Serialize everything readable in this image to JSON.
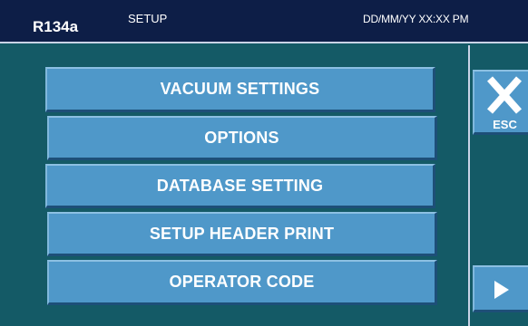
{
  "header": {
    "refrigerant": "R134a",
    "mode": "SETUP",
    "datetime": "DD/MM/YY XX:XX PM"
  },
  "menu": {
    "items": [
      {
        "label": "VACUUM SETTINGS"
      },
      {
        "label": "OPTIONS"
      },
      {
        "label": "DATABASE SETTING"
      },
      {
        "label": "SETUP HEADER PRINT"
      },
      {
        "label": "OPERATOR CODE"
      }
    ]
  },
  "side": {
    "esc_label": "ESC",
    "esc_icon": "close-icon",
    "next_icon": "arrow-right-icon"
  },
  "colors": {
    "background": "#145a66",
    "header": "#0d1e47",
    "button": "#4f98c9",
    "button_shadow": "#1d4f78",
    "text": "#ffffff"
  }
}
